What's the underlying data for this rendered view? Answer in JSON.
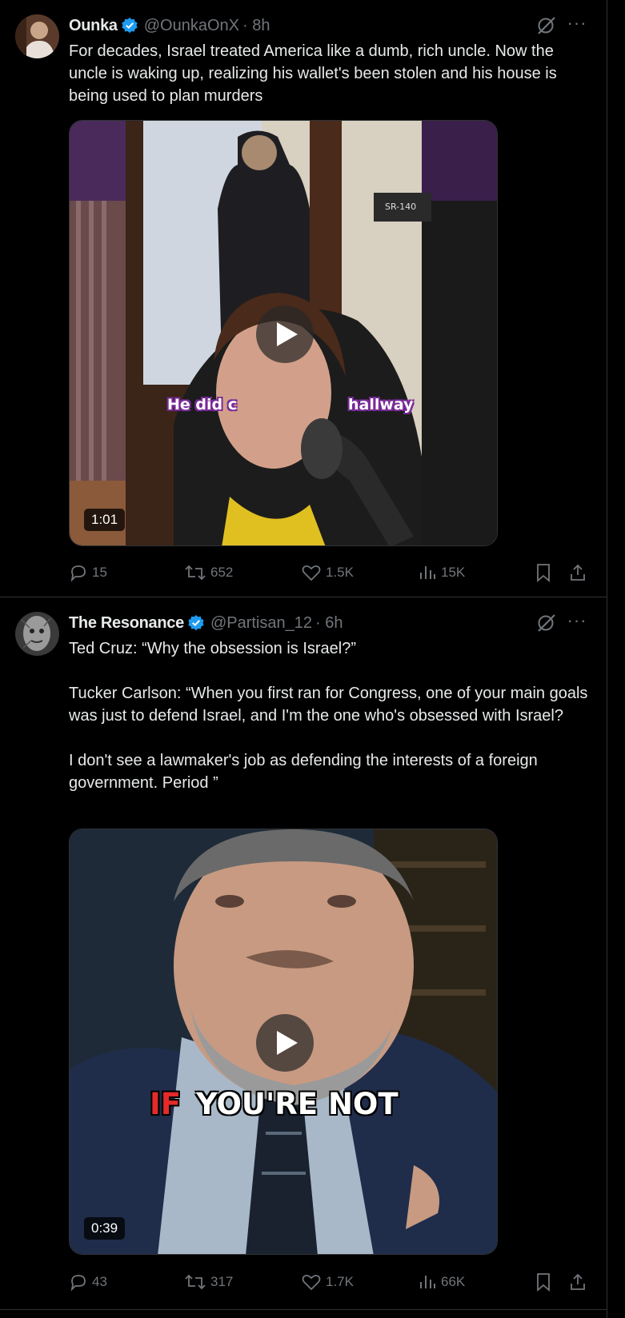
{
  "posts": [
    {
      "display_name": "Ounka",
      "handle": "@OunkaOnX",
      "time": "· 8h",
      "text_lines": [
        "For decades, Israel treated America like a dumb, rich uncle. Now the uncle is waking up, realizing his wallet's been stolen and his house is being used to plan murders"
      ],
      "video": {
        "duration": "1:01",
        "caption_left": "He did c",
        "caption_right": "hallway",
        "sign": "SR-140"
      },
      "stats": {
        "replies": "15",
        "reposts": "652",
        "likes": "1.5K",
        "views": "15K"
      }
    },
    {
      "display_name": "The Resonance",
      "handle": "@Partisan_12",
      "time": "· 6h",
      "text_p1": "Ted Cruz: “Why the obsession is Israel?”",
      "text_p2": "Tucker Carlson: “When you first ran for Congress, one of your main goals was just to defend Israel, and I'm the one who's obsessed with Israel?",
      "text_p3": "I don't see a lawmaker's job as defending the interests of a foreign government. Period ”",
      "video": {
        "duration": "0:39",
        "caption_if": "IF",
        "caption_rest": "YOU'RE NOT"
      },
      "stats": {
        "replies": "43",
        "reposts": "317",
        "likes": "1.7K",
        "views": "66K"
      }
    }
  ],
  "icons": {
    "reply": "reply-icon",
    "repost": "repost-icon",
    "like": "like-icon",
    "views": "views-icon",
    "bookmark": "bookmark-icon",
    "share": "share-icon",
    "grok": "grok-icon",
    "more": "more-icon",
    "verified": "verified-badge-icon",
    "play": "play-icon"
  },
  "colors": {
    "background": "#000000",
    "text": "#e7e9ea",
    "muted": "#71767b",
    "verified": "#1d9bf0",
    "border": "#2f3336"
  }
}
